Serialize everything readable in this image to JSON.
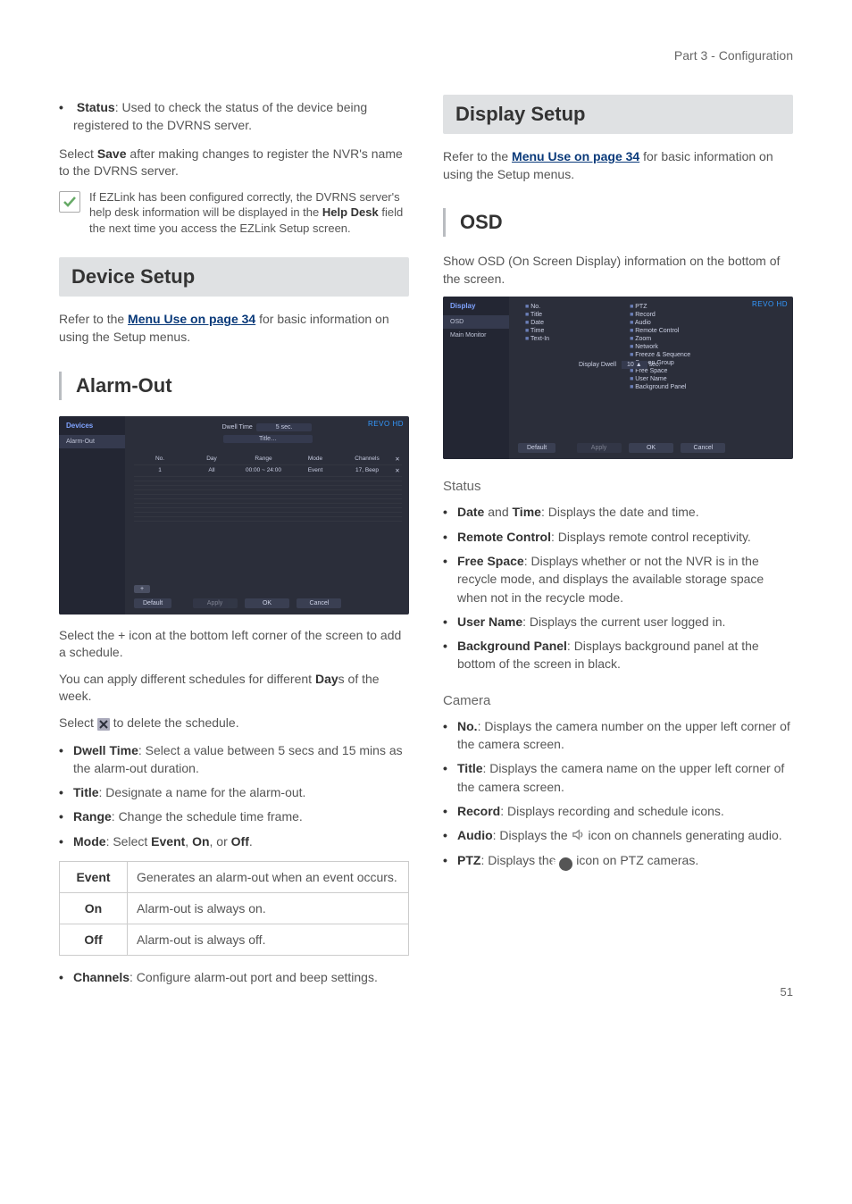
{
  "header": {
    "part": "Part 3 - Configuration"
  },
  "page_number": "51",
  "menu_use_link": "Menu Use on page 34",
  "left": {
    "status_bullet": {
      "lead": "Status",
      "rest": ": Used to check the status of the device being registered to the DVRNS server."
    },
    "save_line_pre": "Select ",
    "save_word": "Save",
    "save_line_post": " after making changes to register the NVR's name to the DVRNS server.",
    "note": "If EZLink has been configured correctly, the DVRNS server's help desk information will be displayed in the Help Desk field the next time you access the EZLink Setup screen.",
    "note_bold": "Help Desk",
    "device_setup_title": "Device Setup",
    "device_setup_intro_pre": "Refer to the ",
    "device_setup_intro_post": " for basic information on using the Setup menus.",
    "alarm_out_title": "Alarm-Out",
    "alarm_screenshot": {
      "sidebar_title": "Devices",
      "sidebar_item": "Alarm-Out",
      "logo": "REVO",
      "logo_suffix": "HD",
      "dwell_label": "Dwell Time",
      "dwell_value": "5 sec.",
      "title_btn": "Title…",
      "headers": [
        "No.",
        "Day",
        "Range",
        "Mode",
        "Channels"
      ],
      "row": [
        "1",
        "All",
        "00:00 ~ 24:00",
        "Event",
        "17, Beep"
      ],
      "add_btn": "+",
      "buttons": [
        "Default",
        "Apply",
        "OK",
        "Cancel"
      ]
    },
    "alarm_p1": "Select the + icon at the bottom left corner of the screen to add a schedule.",
    "alarm_p2_pre": "You can apply different schedules for different ",
    "alarm_p2_bold": "Day",
    "alarm_p2_post": "s of the week.",
    "alarm_p3_pre": "Select ",
    "alarm_p3_post": " to delete the schedule.",
    "alarm_bullets": [
      {
        "lead": "Dwell Time",
        "rest": ": Select a value between 5 secs and 15 mins as the alarm-out duration."
      },
      {
        "lead": "Title",
        "rest": ": Designate a name for the alarm-out."
      },
      {
        "lead": "Range",
        "rest": ": Change the schedule time frame."
      },
      {
        "lead": "Mode",
        "rest": ": Select Event, On, or Off."
      }
    ],
    "mode_inline": {
      "event": "Event",
      "on": "On",
      "off": "Off"
    },
    "mode_table": {
      "event_label": "Event",
      "event_desc": "Generates an alarm-out when an event occurs.",
      "on_label": "On",
      "on_desc": "Alarm-out is always on.",
      "off_label": "Off",
      "off_desc": "Alarm-out is always off."
    },
    "channels_bullet": {
      "lead": "Channels",
      "rest": ": Configure alarm-out port and beep settings."
    }
  },
  "right": {
    "display_setup_title": "Display Setup",
    "display_setup_intro_pre": "Refer to the ",
    "display_setup_intro_post": " for basic information on using the Setup menus.",
    "osd_title": "OSD",
    "osd_intro": "Show OSD (On Screen Display) information on the bottom of the screen.",
    "osd_screenshot": {
      "sidebar_title": "Display",
      "sidebar_items": [
        "OSD",
        "Main Monitor"
      ],
      "logo": "REVO",
      "logo_suffix": "HD",
      "left_checks": [
        "No.",
        "Title",
        "Date",
        "Time",
        "Text-In"
      ],
      "right_checks": [
        "PTZ",
        "Record",
        "Audio",
        "Remote Control",
        "Zoom",
        "Network",
        "Freeze & Sequence",
        "Screen Group",
        "Free Space",
        "User Name",
        "Background Panel"
      ],
      "dwell_label": "Display Dwell",
      "dwell_value": "10",
      "dwell_unit": "sec.",
      "buttons": [
        "Default",
        "Apply",
        "OK",
        "Cancel"
      ]
    },
    "status_head": "Status",
    "status_bullets": [
      {
        "lead": "Date",
        "mid": " and ",
        "lead2": "Time",
        "rest": ": Displays the date and time."
      },
      {
        "lead": "Remote Control",
        "rest": ": Displays remote control receptivity."
      },
      {
        "lead": "Free Space",
        "rest": ": Displays whether or not the NVR is in the recycle mode, and displays the available storage space when not in the recycle mode."
      },
      {
        "lead": "User Name",
        "rest": ": Displays the current user logged in."
      },
      {
        "lead": "Background Panel",
        "rest": ": Displays background panel at the bottom of the screen in black."
      }
    ],
    "camera_head": "Camera",
    "camera_bullets": [
      {
        "lead": "No.",
        "rest": ": Displays the camera number on the upper left corner of the camera screen."
      },
      {
        "lead": "Title",
        "rest": ": Displays the camera name on the upper left corner of the camera screen."
      },
      {
        "lead": "Record",
        "rest": ": Displays recording and schedule icons."
      },
      {
        "lead": "Audio",
        "rest_pre": ": Displays the ",
        "rest_post": " icon on channels generating audio."
      },
      {
        "lead": "PTZ",
        "rest_pre": ": Displays the ",
        "rest_post": " icon on PTZ cameras."
      }
    ]
  }
}
